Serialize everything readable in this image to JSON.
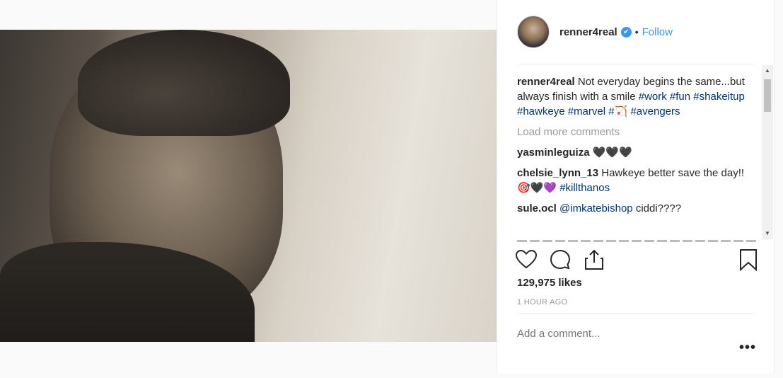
{
  "post": {
    "username": "renner4real",
    "follow_label": "Follow",
    "dot": "•",
    "verified_glyph": "✔"
  },
  "caption": {
    "username": "renner4real",
    "text": "Not everyday begins the same...but always finish with a smile",
    "tags": [
      "#work",
      "#fun",
      "#shakeitup",
      "#hawkeye",
      "#marvel",
      "#🏹",
      "#avengers"
    ]
  },
  "load_more_label": "Load more comments",
  "comments": [
    {
      "username": "yasminleguiza",
      "text": "🖤🖤🖤"
    },
    {
      "username": "chelsie_lynn_13",
      "text": "Hawkeye better save the day!! 🎯🖤💜",
      "tag": "#killthanos"
    },
    {
      "username": "sule.ocl",
      "mention": "@imkatebishop",
      "text": "ciddi????"
    }
  ],
  "likes": "129,975 likes",
  "timestamp": "1 HOUR AGO",
  "add_comment_placeholder": "Add a comment...",
  "more_label": "•••",
  "scroll": {
    "up": "▲",
    "down": "▼"
  },
  "icons": [
    "heart-icon",
    "comment-icon",
    "share-icon",
    "bookmark-icon"
  ],
  "colors": {
    "link": "#3897f0",
    "hashtag": "#003569",
    "muted": "#999999"
  }
}
